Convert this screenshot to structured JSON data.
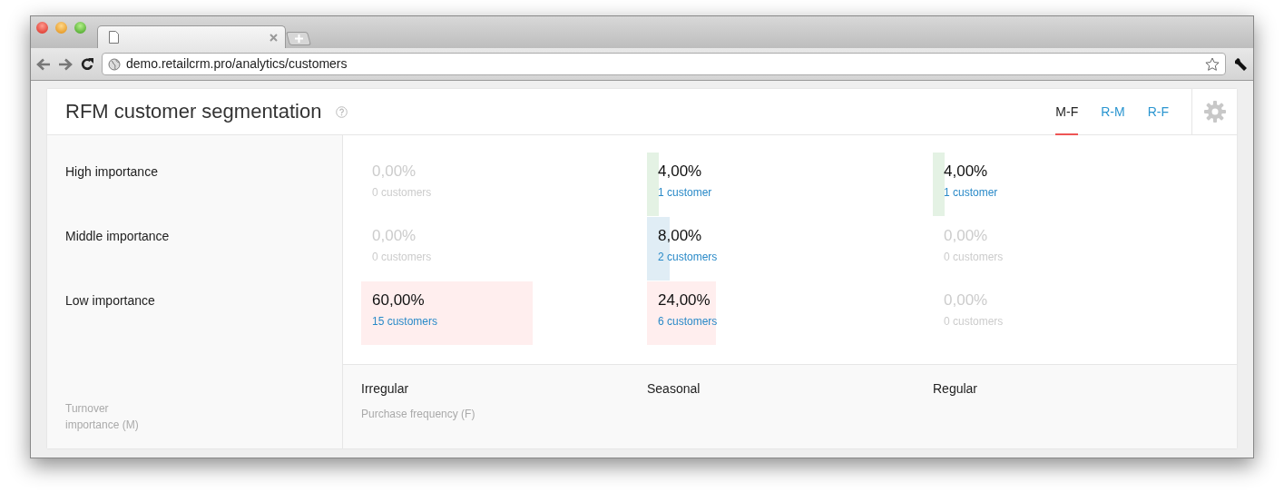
{
  "browser": {
    "url": "demo.retailcrm.pro/analytics/customers"
  },
  "report": {
    "title": "RFM customer segmentation",
    "tabs": [
      {
        "label": "M-F",
        "selected": true
      },
      {
        "label": "R-M",
        "selected": false
      },
      {
        "label": "R-F",
        "selected": false
      }
    ],
    "importance_levels": [
      {
        "label": "High importance",
        "color": "#e4f2e4",
        "segments": [
          {
            "percent": "0,00%",
            "count": "0 customers"
          },
          {
            "percent": "4,00%",
            "count": "1 customer"
          },
          {
            "percent": "4,00%",
            "count": "1 customer"
          }
        ]
      },
      {
        "label": "Middle importance",
        "color": "#e0edf5",
        "segments": [
          {
            "percent": "0,00%",
            "count": "0 customers"
          },
          {
            "percent": "8,00%",
            "count": "2 customers"
          },
          {
            "percent": "0,00%",
            "count": "0 customers"
          }
        ]
      },
      {
        "label": "Low importance",
        "color": "#ffeeee",
        "segments": [
          {
            "percent": "60,00%",
            "count": "15 customers"
          },
          {
            "percent": "24,00%",
            "count": "6 customers"
          },
          {
            "percent": "0,00%",
            "count": "0 customers"
          }
        ]
      }
    ],
    "frequency_groups": [
      "Irregular",
      "Seasonal",
      "Regular"
    ],
    "x_axis_label": "Purchase frequency (F)",
    "y_axis_label": "Turnover importance (M)"
  }
}
